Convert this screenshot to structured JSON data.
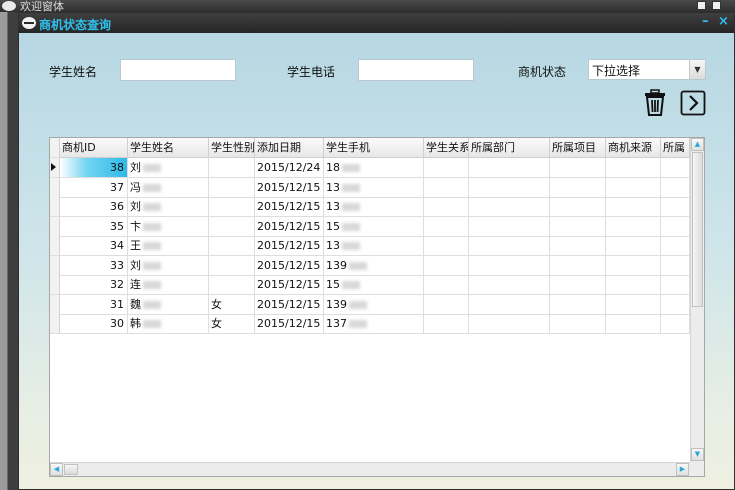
{
  "outer_window": {
    "title": "欢迎窗体"
  },
  "window": {
    "title": "商机状态查询",
    "min_glyph": "–",
    "close_glyph": "×"
  },
  "filters": {
    "student_name_label": "学生姓名",
    "student_name_value": "",
    "student_phone_label": "学生电话",
    "student_phone_value": "",
    "status_label": "商机状态",
    "status_selected": "下拉选择",
    "status_arrow": "▼"
  },
  "toolbar": {
    "delete_icon": "trash-icon",
    "next_icon": "chevron-right-icon"
  },
  "grid": {
    "columns": [
      "商机ID",
      "学生姓名",
      "学生性别",
      "添加日期",
      "学生手机",
      "学生关系",
      "所属部门",
      "所属项目",
      "商机来源",
      "所属"
    ],
    "rows": [
      [
        "38",
        "刘",
        "",
        "2015/12/24",
        "18",
        "",
        "",
        "",
        "",
        ""
      ],
      [
        "37",
        "冯",
        "",
        "2015/12/15",
        "13",
        "",
        "",
        "",
        "",
        ""
      ],
      [
        "36",
        "刘",
        "",
        "2015/12/15",
        "13",
        "",
        "",
        "",
        "",
        ""
      ],
      [
        "35",
        "卞",
        "",
        "2015/12/15",
        "15",
        "",
        "",
        "",
        "",
        ""
      ],
      [
        "34",
        "王",
        "",
        "2015/12/15",
        "13",
        "",
        "",
        "",
        "",
        ""
      ],
      [
        "33",
        "刘",
        "",
        "2015/12/15",
        "139",
        "",
        "",
        "",
        "",
        ""
      ],
      [
        "32",
        "连",
        "",
        "2015/12/15",
        "15",
        "",
        "",
        "",
        "",
        ""
      ],
      [
        "31",
        "魏",
        "女",
        "2015/12/15",
        "139",
        "",
        "",
        "",
        "",
        ""
      ],
      [
        "30",
        "韩",
        "女",
        "2015/12/15",
        "137",
        "",
        "",
        "",
        "",
        ""
      ]
    ],
    "selected_row": 0,
    "scroll": {
      "up": "▲",
      "down": "▼",
      "left": "◀",
      "right": "▶"
    }
  },
  "colors": {
    "title_accent": "#2fc0ee",
    "selection": "#2fb9ea"
  }
}
